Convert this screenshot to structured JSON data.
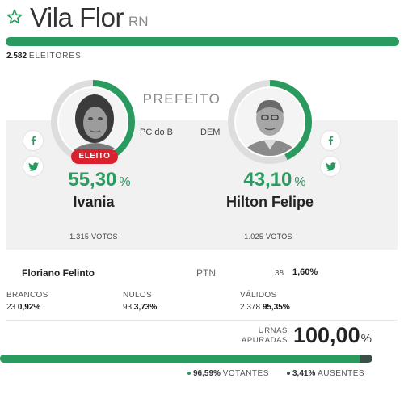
{
  "header": {
    "city": "Vila Flor",
    "state": "RN",
    "voters_count": "2.582",
    "voters_label": "ELEITORES"
  },
  "office": "PREFEITO",
  "candidates": [
    {
      "name": "Ivania",
      "party": "PC do B",
      "percent": "55,30",
      "percent_unit": "%",
      "votes": "1.315",
      "votes_label": "VOTOS",
      "badge": "ELEITO",
      "ring_fraction": 0.553
    },
    {
      "name": "Hilton Felipe",
      "party": "DEM",
      "percent": "43,10",
      "percent_unit": "%",
      "votes": "1.025",
      "votes_label": "VOTOS",
      "ring_fraction": 0.431
    }
  ],
  "others": [
    {
      "name": "Floriano Felinto",
      "party": "PTN",
      "votes": "38",
      "percent": "1,60%"
    }
  ],
  "stats": {
    "brancos": {
      "label": "BRANCOS",
      "count": "23",
      "percent": "0,92%"
    },
    "nulos": {
      "label": "NULOS",
      "count": "93",
      "percent": "3,73%"
    },
    "validos": {
      "label": "VÁLIDOS",
      "count": "2.378",
      "percent": "95,35%"
    }
  },
  "urnas": {
    "label_line1": "URNAS",
    "label_line2": "APURADAS",
    "value": "100,00",
    "unit": "%",
    "fraction": 1.0
  },
  "turnout": {
    "votantes_percent": "96,59%",
    "votantes_label": "VOTANTES",
    "ausentes_percent": "3,41%",
    "ausentes_label": "AUSENTES",
    "votantes_fraction": 0.9659
  },
  "colors": {
    "accent": "#2a9a5f",
    "dark": "#3a4f45",
    "elected_badge": "#d8232f",
    "panel": "#f1f1f1"
  },
  "icons": [
    "star-outline-icon",
    "facebook-icon",
    "twitter-icon"
  ]
}
